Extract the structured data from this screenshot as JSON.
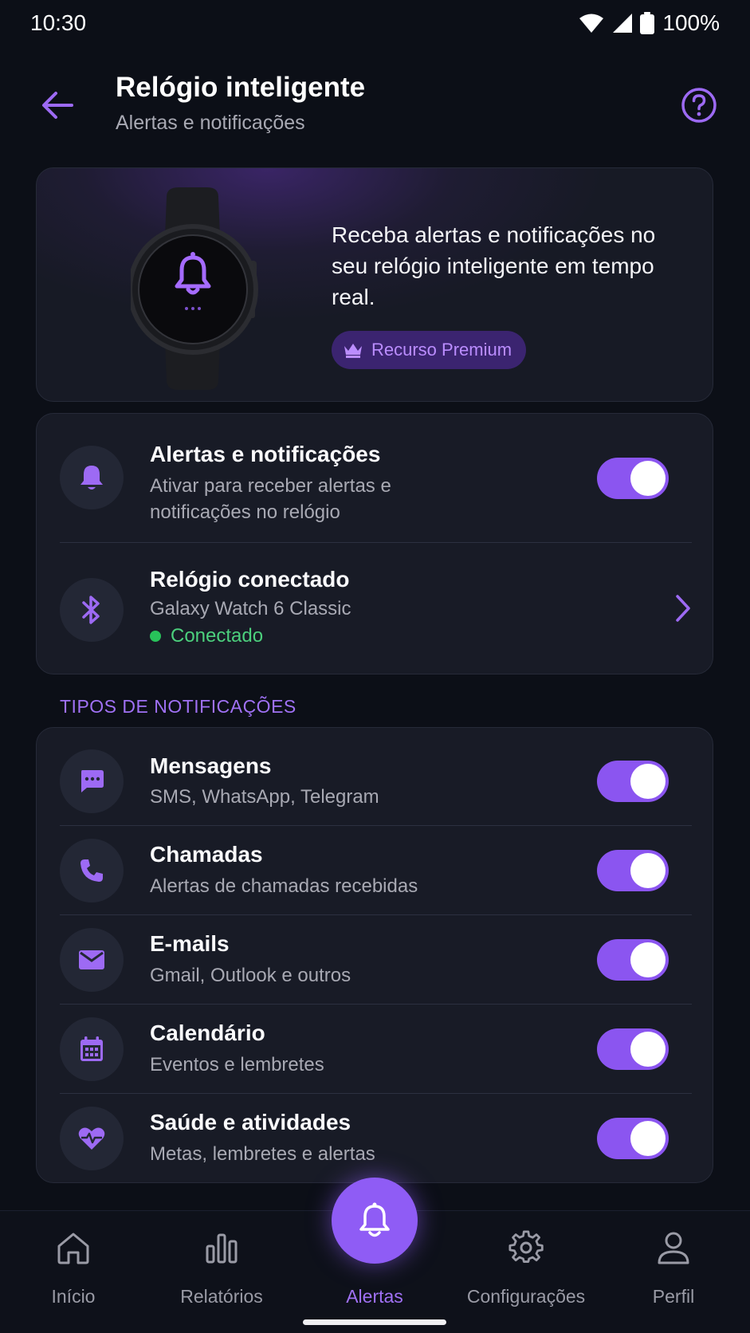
{
  "status_bar": {
    "time": "10:30",
    "battery": "100%"
  },
  "header": {
    "title": "Relógio inteligente",
    "subtitle": "Alertas e notificações"
  },
  "hero": {
    "text": "Receba alertas e notificações no seu relógio inteligente em tempo real.",
    "premium_label": "Recurso Premium"
  },
  "settings": {
    "alerts": {
      "title": "Alertas e notificações",
      "subtitle": "Ativar para receber alertas e notificações no relógio",
      "enabled": true
    },
    "watch": {
      "title": "Relógio conectado",
      "device": "Galaxy Watch 6 Classic",
      "status": "Conectado"
    }
  },
  "types_section": {
    "label": "TIPOS DE NOTIFICAÇÕES",
    "items": [
      {
        "title": "Mensagens",
        "subtitle": "SMS, WhatsApp, Telegram",
        "icon": "message-icon",
        "enabled": true
      },
      {
        "title": "Chamadas",
        "subtitle": "Alertas de chamadas recebidas",
        "icon": "phone-icon",
        "enabled": true
      },
      {
        "title": "E-mails",
        "subtitle": "Gmail, Outlook e outros",
        "icon": "mail-icon",
        "enabled": true
      },
      {
        "title": "Calendário",
        "subtitle": "Eventos e lembretes",
        "icon": "calendar-icon",
        "enabled": true
      },
      {
        "title": "Saúde e atividades",
        "subtitle": "Metas, lembretes e alertas",
        "icon": "heart-pulse-icon",
        "enabled": true
      }
    ]
  },
  "nav": {
    "items": [
      {
        "label": "Início",
        "icon": "home-icon"
      },
      {
        "label": "Relatórios",
        "icon": "bar-chart-icon"
      },
      {
        "label": "Alertas",
        "icon": "bell-icon",
        "active": true
      },
      {
        "label": "Configurações",
        "icon": "gear-icon"
      },
      {
        "label": "Perfil",
        "icon": "person-icon"
      }
    ]
  },
  "colors": {
    "accent": "#8b55f0",
    "accent_text": "#a071f5",
    "background": "#0c0f17",
    "card": "#181b26",
    "connected": "#28c25a"
  }
}
